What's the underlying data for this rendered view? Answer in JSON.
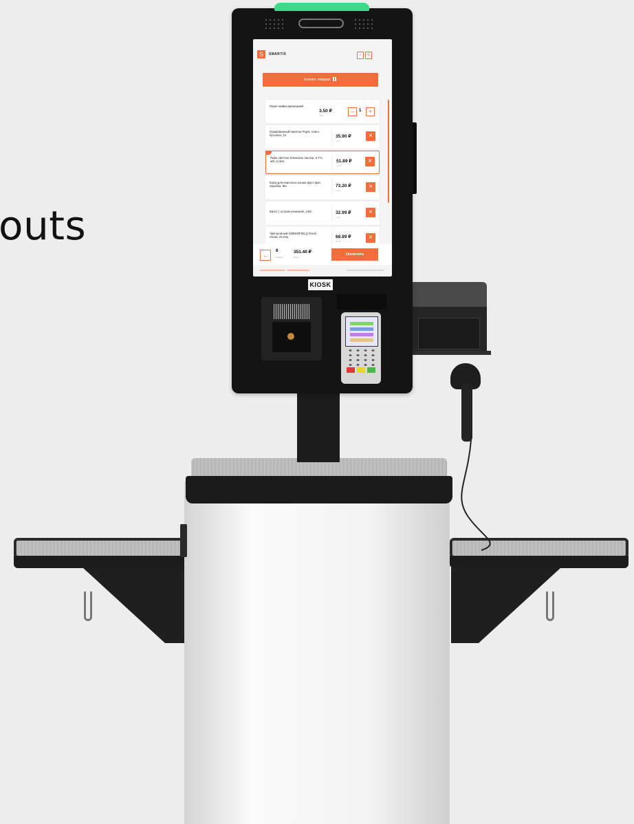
{
  "headline": "outs",
  "kiosk": {
    "brand": "SMARTIX",
    "catalog_button": "Каталог товаров",
    "items": [
      {
        "name": "Пакет-майка маленький",
        "price": "3.50 ₽",
        "unit": "1 шт",
        "qty": "1",
        "control": "stepper"
      },
      {
        "name": "Газированный напиток Pepsi, пласт. бутылка, 1л",
        "price": "35.90 ₽",
        "unit": "1 шт",
        "control": "remove"
      },
      {
        "name": "Пиво светлое Клинское пастер. 4,7%, ж/б, 0,45л",
        "price": "51.89 ₽",
        "unit": "1 шт",
        "control": "remove",
        "highlighted": true
      },
      {
        "name": "Корм для взрослых кошек фаст фит, коробка, 85г",
        "price": "73.20 ₽",
        "unit": "1 шт",
        "control": "remove"
      },
      {
        "name": "Багет с острой начинкой, 140г",
        "price": "32.99 ₽",
        "unit": "1 шт",
        "control": "remove"
      },
      {
        "name": "Чай зеленый GREENFIELD Floral Cloud, 25 пак.",
        "price": "68.89 ₽",
        "unit": "1 шт",
        "control": "remove"
      }
    ],
    "footer": {
      "count": "8",
      "count_label": "Товаров",
      "total": "351.40 ₽",
      "total_label": "Итого",
      "pay_button": "Оплатить"
    },
    "label_plate": "KIOSK",
    "colors": {
      "accent": "#f36c3b",
      "frame": "#141414",
      "sensor": "#3fd98a"
    }
  }
}
